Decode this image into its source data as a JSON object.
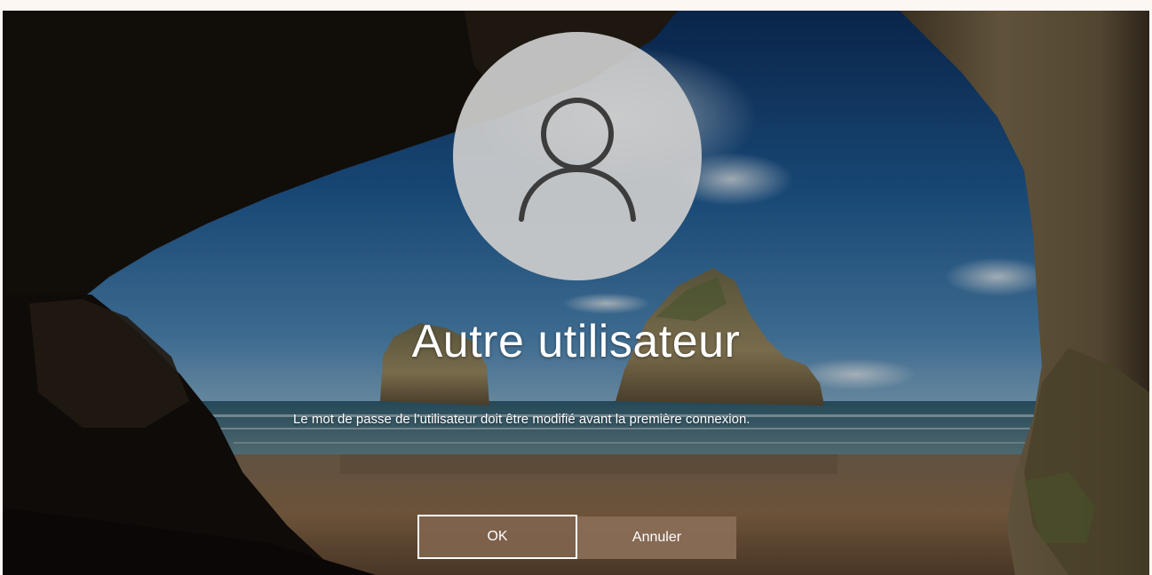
{
  "login": {
    "user_name": "Autre utilisateur",
    "message": "Le mot de passe de l’utilisateur doit être modifié avant la première connexion.",
    "avatar_icon": "user-silhouette-icon"
  },
  "buttons": {
    "ok_label": "OK",
    "cancel_label": "Annuler"
  },
  "colors": {
    "avatar_background": "#cccccc",
    "button_background": "#8a6e58",
    "focus_border": "#ffffff",
    "text": "#ffffff"
  }
}
